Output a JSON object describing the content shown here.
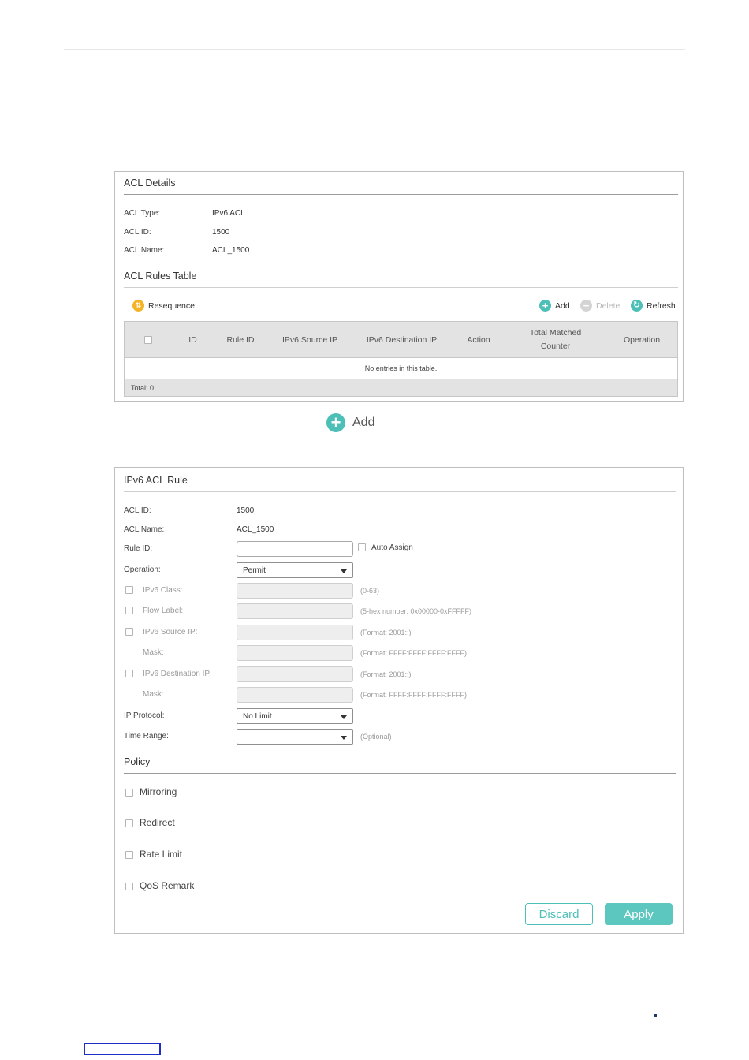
{
  "details": {
    "title": "ACL Details",
    "rows": [
      {
        "label": "ACL Type:",
        "value": "IPv6 ACL"
      },
      {
        "label": "ACL ID:",
        "value": "1500"
      },
      {
        "label": "ACL Name:",
        "value": "ACL_1500"
      }
    ]
  },
  "rules_table": {
    "title": "ACL Rules Table",
    "toolbar": {
      "resequence": "Resequence",
      "add": "Add",
      "delete": "Delete",
      "refresh": "Refresh"
    },
    "columns": [
      "ID",
      "Rule ID",
      "IPv6 Source IP",
      "IPv6 Destination IP",
      "Action",
      "Total Matched Counter",
      "Operation"
    ],
    "empty_text": "No entries in this table.",
    "total": "Total: 0"
  },
  "caption": {
    "add_label": "Add"
  },
  "rule_form": {
    "title": "IPv6 ACL Rule",
    "acl_id": {
      "label": "ACL ID:",
      "value": "1500"
    },
    "acl_name": {
      "label": "ACL Name:",
      "value": "ACL_1500"
    },
    "rule_id": {
      "label": "Rule ID:",
      "value": "",
      "auto_assign": "Auto Assign"
    },
    "operation": {
      "label": "Operation:",
      "value": "Permit"
    },
    "ipv6_class": {
      "label": "IPv6 Class:",
      "hint": "(0-63)"
    },
    "flow_label": {
      "label": "Flow Label:",
      "hint": "(5-hex number: 0x00000-0xFFFFF)"
    },
    "source_ip": {
      "label": "IPv6 Source IP:",
      "hint": "(Format: 2001::)"
    },
    "source_mask": {
      "label": "Mask:",
      "hint": "(Format: FFFF:FFFF:FFFF:FFFF)"
    },
    "dest_ip": {
      "label": "IPv6 Destination IP:",
      "hint": "(Format: 2001::)"
    },
    "dest_mask": {
      "label": "Mask:",
      "hint": "(Format: FFFF:FFFF:FFFF:FFFF)"
    },
    "ip_protocol": {
      "label": "IP Protocol:",
      "value": "No Limit"
    },
    "time_range": {
      "label": "Time Range:",
      "value": "",
      "hint": "(Optional)"
    }
  },
  "policy": {
    "title": "Policy",
    "items": [
      "Mirroring",
      "Redirect",
      "Rate Limit",
      "QoS Remark"
    ]
  },
  "buttons": {
    "discard": "Discard",
    "apply": "Apply"
  },
  "colors": {
    "accent": "#5cc7bf",
    "resequence_icon": "#f5b325",
    "add_icon": "#4cbfb7",
    "disabled": "#b9b9b9"
  }
}
